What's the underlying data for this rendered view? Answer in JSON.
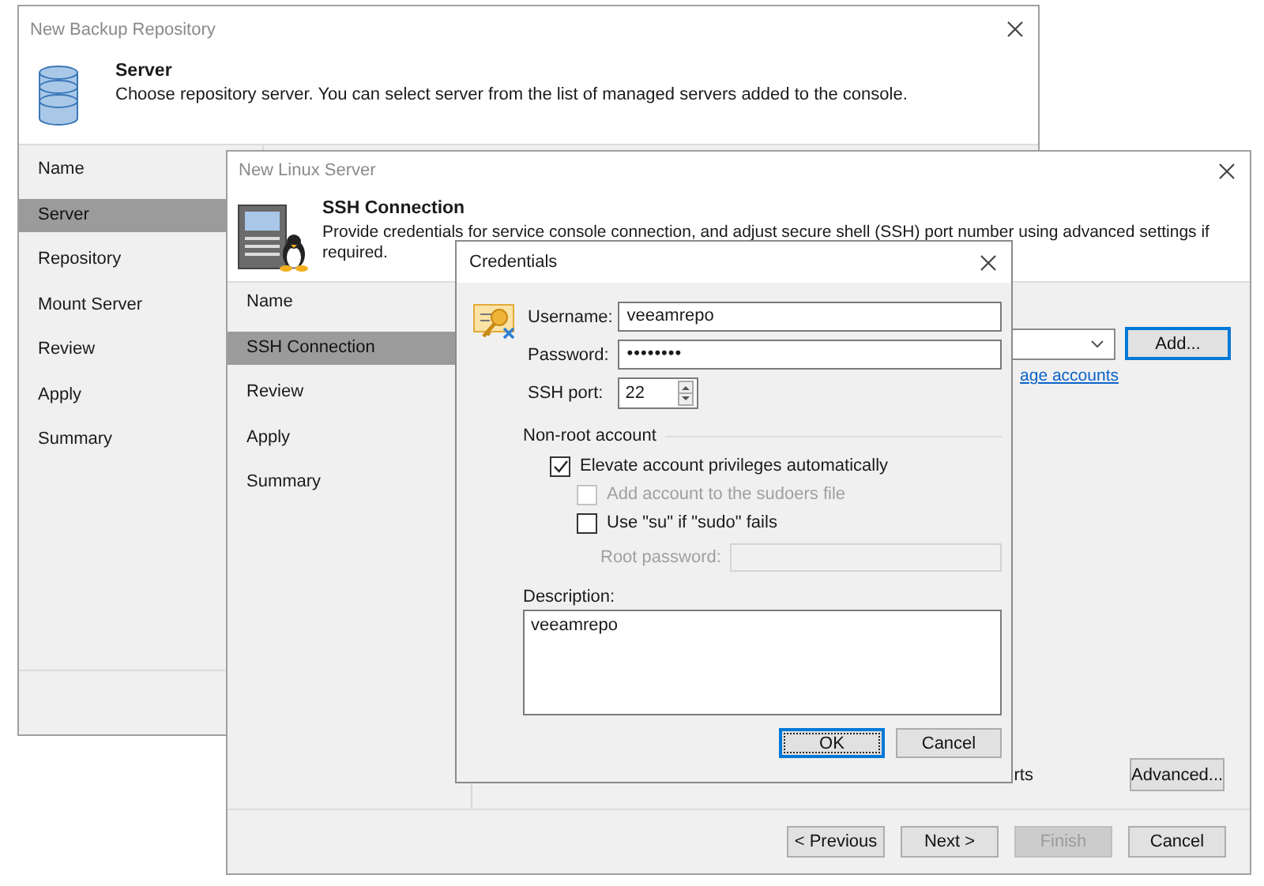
{
  "backup_window": {
    "title": "New Backup Repository",
    "heading": "Server",
    "description": "Choose repository server. You can select server from the list of managed servers added to the console.",
    "steps": [
      {
        "label": "Name",
        "selected": false
      },
      {
        "label": "Server",
        "selected": true
      },
      {
        "label": "Repository",
        "selected": false
      },
      {
        "label": "Mount Server",
        "selected": false
      },
      {
        "label": "Review",
        "selected": false
      },
      {
        "label": "Apply",
        "selected": false
      },
      {
        "label": "Summary",
        "selected": false
      }
    ]
  },
  "linux_window": {
    "title": "New Linux Server",
    "heading": "SSH Connection",
    "description_lines": [
      "Provide credentials for service console connection, and adjust secure shell (SSH) port number using advanced settings if",
      "required."
    ],
    "steps": [
      {
        "label": "Name",
        "selected": false
      },
      {
        "label": "SSH Connection",
        "selected": true
      },
      {
        "label": "Review",
        "selected": false
      },
      {
        "label": "Apply",
        "selected": false
      },
      {
        "label": "Summary",
        "selected": false
      }
    ],
    "add_button": {
      "label": "Add...",
      "focused": true
    },
    "link": "age accounts",
    "partial_text": "rts",
    "advanced_button": {
      "label": "Advanced...",
      "focused": false
    },
    "footer_buttons": [
      {
        "label": "< Previous",
        "disabled": false
      },
      {
        "label": "Next >",
        "disabled": false
      },
      {
        "label": "Finish",
        "disabled": true
      },
      {
        "label": "Cancel",
        "disabled": false
      }
    ]
  },
  "credentials_dialog": {
    "title": "Credentials",
    "fields": [
      {
        "kind": "text",
        "label": "Username:",
        "value": "veeamrepo"
      },
      {
        "kind": "password",
        "label": "Password:",
        "value": "••••••••"
      },
      {
        "kind": "spinner",
        "label": "SSH port:",
        "value": "22"
      }
    ],
    "group_label": "Non-root account",
    "options": [
      {
        "label": "Elevate account privileges automatically",
        "checked": true,
        "disabled": false,
        "children": [
          {
            "label": "Add account to the sudoers file",
            "checked": false,
            "disabled": true
          },
          {
            "label": "Use \"su\" if \"sudo\" fails",
            "checked": false,
            "disabled": false
          }
        ]
      }
    ],
    "root_password": {
      "label": "Root password:",
      "disabled": true
    },
    "description_label": "Description:",
    "description": "veeamrepo",
    "buttons": [
      {
        "label": "OK",
        "focused": true
      },
      {
        "label": "Cancel",
        "focused": false
      }
    ]
  }
}
